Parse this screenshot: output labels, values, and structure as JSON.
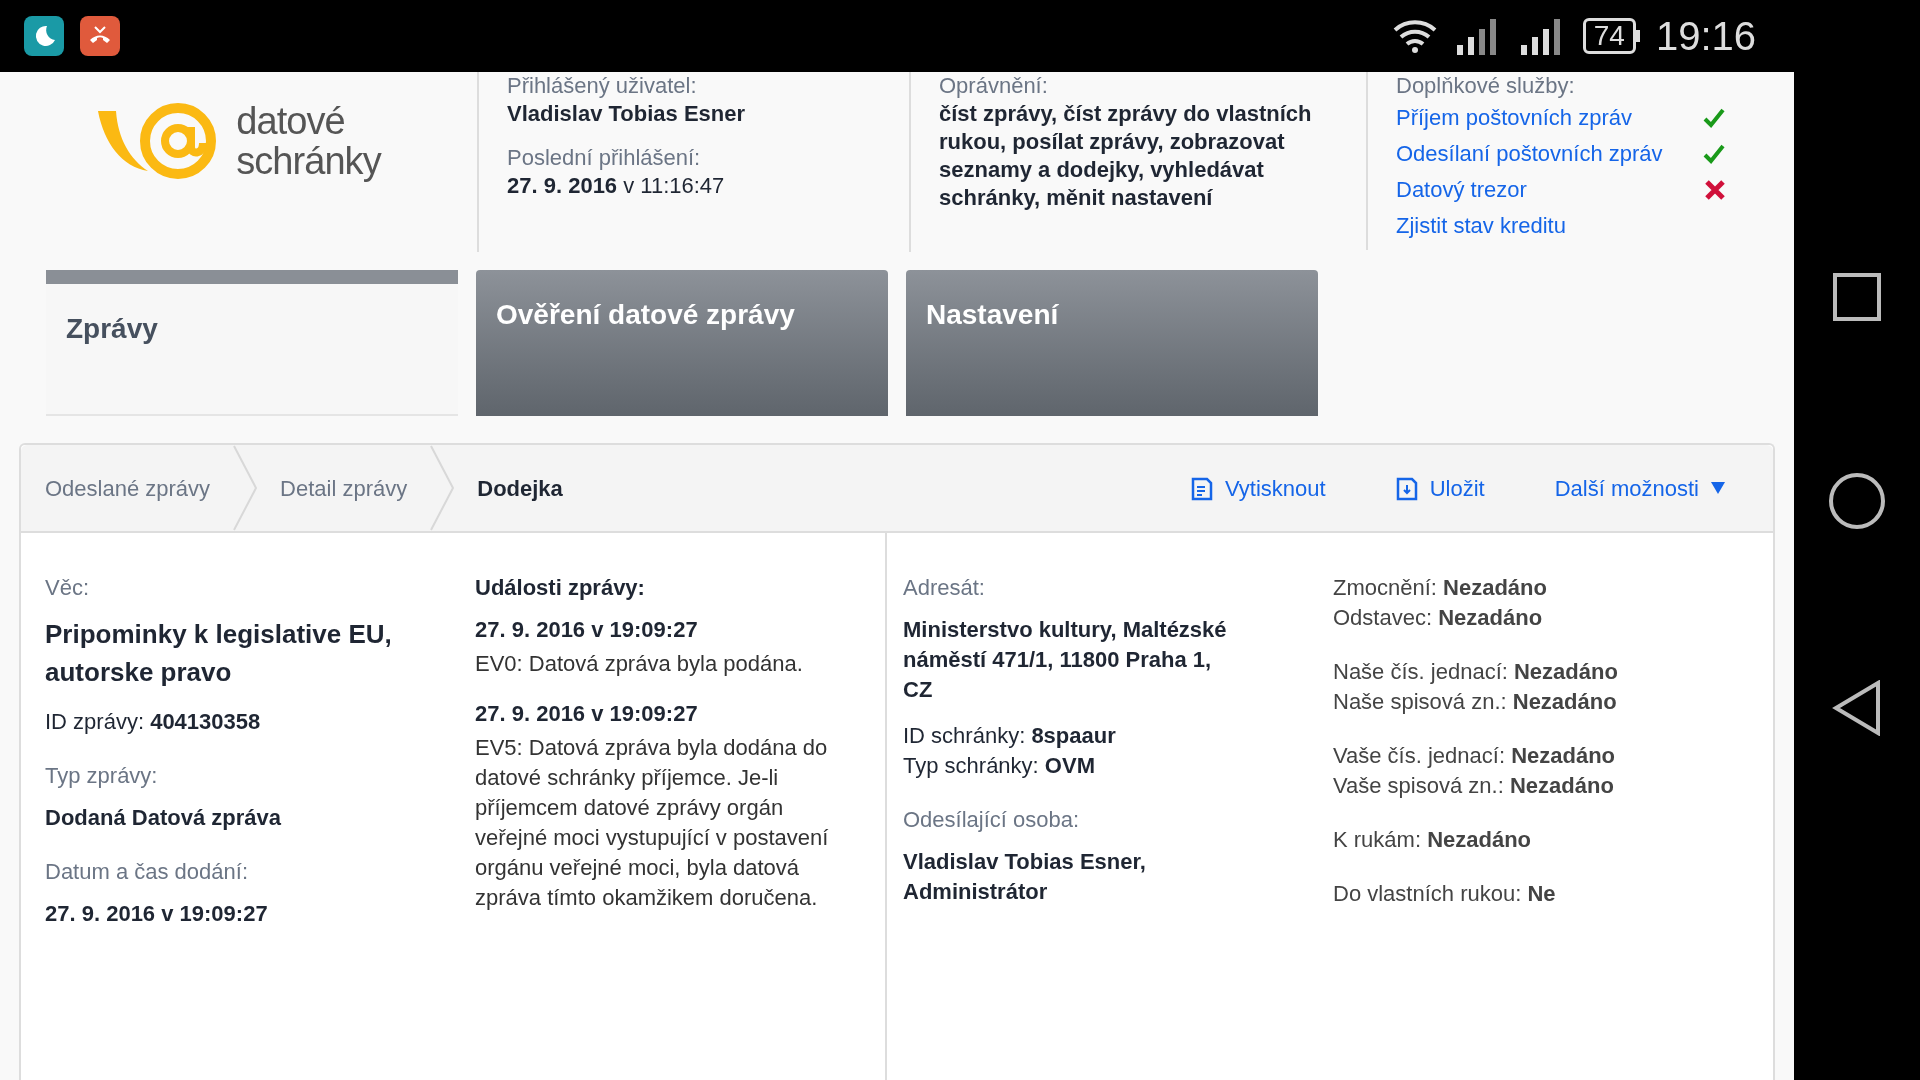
{
  "status_bar": {
    "battery": "74",
    "time": "19:16"
  },
  "header": {
    "logo": {
      "line1": "datové",
      "line2": "schránky"
    },
    "user": {
      "label": "Přihlášený uživatel:",
      "name": "Vladislav Tobias Esner",
      "last_login_label": "Poslední přihlášení:",
      "last_login": "**27. 9. 2016** v 11:16:47"
    },
    "permissions": {
      "label": "Oprávnění:",
      "text": "číst zprávy, číst zprávy do vlastních rukou, posílat zprávy, zobrazovat seznamy a dodejky, vyhledávat schránky, měnit nastavení"
    },
    "services": {
      "label": "Doplňkové služby:",
      "items": [
        {
          "label": "Příjem poštovních zpráv",
          "active": true
        },
        {
          "label": "Odesílaní poštovních zpráv",
          "active": true
        },
        {
          "label": "Datový trezor",
          "active": false
        },
        {
          "label": "Zjistit stav kreditu"
        }
      ]
    }
  },
  "tabs": [
    {
      "label": "Zprávy",
      "selected": true
    },
    {
      "label": "Ověření datové zprávy",
      "selected": false
    },
    {
      "label": "Nastavení",
      "selected": false
    }
  ],
  "breadcrumbs": [
    {
      "label": "Odeslané zprávy",
      "selected": false
    },
    {
      "label": "Detail zprávy",
      "selected": false
    },
    {
      "label": "Dodejka",
      "selected": true
    }
  ],
  "actions": [
    {
      "label": "Vytisknout",
      "kind": "print"
    },
    {
      "label": "Uložit",
      "kind": "save"
    },
    {
      "label": "Další možnosti",
      "kind": "menu"
    }
  ],
  "message": {
    "subject_label": "Věc:",
    "subject": "Pripominky k legislative EU, autorske pravo",
    "id": "ID zprávy: **404130358**",
    "type_label": "Typ zprávy:",
    "type": "Dodaná Datová zpráva",
    "delivered_label": "Datum a čas dodání:",
    "delivered": "27. 9. 2016 v 19:09:27"
  },
  "events": {
    "title": "Události zprávy:",
    "items": [
      {
        "time": "27. 9. 2016 v 19:09:27",
        "text": "EV0: Datová zpráva byla podána."
      },
      {
        "time": "27. 9. 2016 v 19:09:27",
        "text": "EV5: Datová zpráva byla dodána do datové schránky příjemce. Je-li příjemcem datové zprávy orgán veřejné moci vystupující v postavení orgánu veřejné moci, byla datová zpráva tímto okamžikem doručena."
      }
    ]
  },
  "recipient": {
    "label": "Adresát:",
    "address": "Ministerstvo kultury, Maltézské náměstí 471/1, 11800 Praha 1, CZ",
    "box_lines": [
      "ID schránky: **8spaaur**",
      "Typ schránky: **OVM**"
    ],
    "sender_label": "Odesílající osoba:",
    "sender": "Vladislav Tobias Esner, Administrátor"
  },
  "details": [
    [
      "Zmocnění: **Nezadáno**",
      "Odstavec: **Nezadáno**"
    ],
    [
      "Naše čís. jednací: **Nezadáno**",
      "Naše spisová zn.: **Nezadáno**"
    ],
    [
      "Vaše čís. jednací: **Nezadáno**",
      "Vaše spisová zn.: **Nezadáno**"
    ],
    [
      "K rukám: **Nezadáno**"
    ],
    [
      "Do vlastních rukou: **Ne**"
    ]
  ]
}
